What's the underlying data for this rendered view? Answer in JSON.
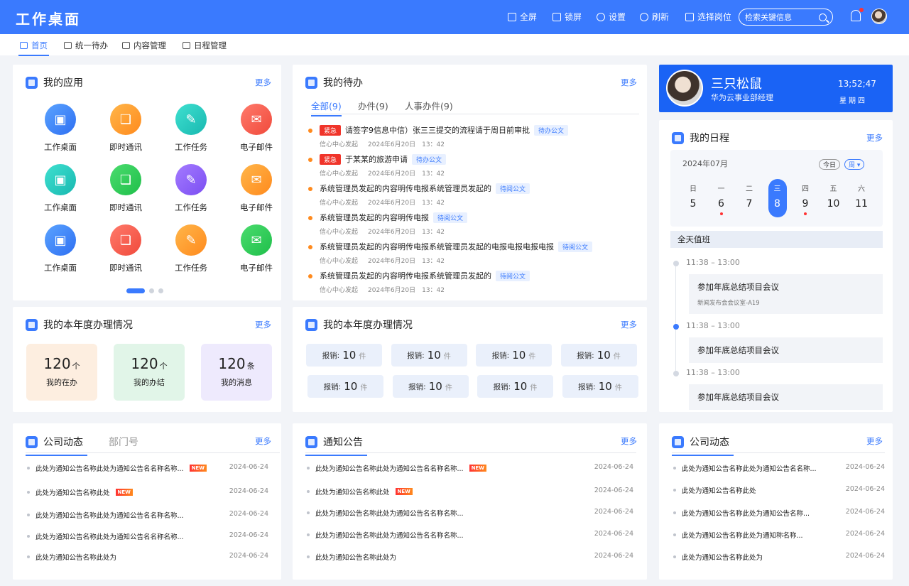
{
  "header": {
    "title": "工作桌面",
    "actions": [
      {
        "label": "全屏",
        "icon": "fullscreen-icon"
      },
      {
        "label": "锁屏",
        "icon": "lock-icon"
      },
      {
        "label": "设置",
        "icon": "gear-icon"
      },
      {
        "label": "刷新",
        "icon": "refresh-icon"
      },
      {
        "label": "选择岗位",
        "icon": "select-icon"
      }
    ],
    "search_placeholder": "检索关键信息",
    "accent": "#3a7afe"
  },
  "nav": {
    "tabs": [
      {
        "label": "首页"
      },
      {
        "label": "统一待办"
      },
      {
        "label": "内容管理"
      },
      {
        "label": "日程管理"
      }
    ]
  },
  "apps": {
    "title": "我的应用",
    "more": "更多",
    "items": [
      {
        "label": "工作桌面",
        "icon": "monitor-icon",
        "color": "blue"
      },
      {
        "label": "即时通讯",
        "icon": "chat-icon",
        "color": "orange"
      },
      {
        "label": "工作任务",
        "icon": "task-icon",
        "color": "teal"
      },
      {
        "label": "电子邮件",
        "icon": "mail-icon",
        "color": "red"
      },
      {
        "label": "工作桌面",
        "icon": "monitor-icon",
        "color": "teal"
      },
      {
        "label": "即时通讯",
        "icon": "chat-icon",
        "color": "green"
      },
      {
        "label": "工作任务",
        "icon": "task-icon",
        "color": "purple"
      },
      {
        "label": "电子邮件",
        "icon": "mail-icon",
        "color": "orange"
      },
      {
        "label": "工作桌面",
        "icon": "monitor-icon",
        "color": "blue"
      },
      {
        "label": "即时通讯",
        "icon": "chat-icon",
        "color": "red"
      },
      {
        "label": "工作任务",
        "icon": "task-icon",
        "color": "orange"
      },
      {
        "label": "电子邮件",
        "icon": "mail-icon",
        "color": "green"
      }
    ]
  },
  "todo": {
    "title": "我的待办",
    "more": "更多",
    "tabs": [
      "全部(9)",
      "办件(9)",
      "人事办件(9)"
    ],
    "urgent_label": "紧急",
    "items": [
      {
        "urgent": true,
        "text": "请签字9信息中信）张三三提交的流程请于周日前审批",
        "tag": "待办公文",
        "source": "信心中心发起",
        "time": "2024年6月20日　13：42"
      },
      {
        "urgent": true,
        "text": "于某某的旅游申请",
        "tag": "待办公文",
        "source": "信心中心发起",
        "time": "2024年6月20日　13：42"
      },
      {
        "urgent": false,
        "text": "系统管理员发起的内容明传电报系统管理员发起的",
        "tag": "待阅公文",
        "source": "信心中心发起",
        "time": "2024年6月20日　13：42"
      },
      {
        "urgent": false,
        "text": "系统管理员发起的内容明传电报",
        "tag": "待阅公文",
        "source": "信心中心发起",
        "time": "2024年6月20日　13：42"
      },
      {
        "urgent": false,
        "text": "系统管理员发起的内容明传电报系统管理员发起的电报电报电报电报",
        "tag": "待阅公文",
        "source": "信心中心发起",
        "time": "2024年6月20日　13：42"
      },
      {
        "urgent": false,
        "text": "系统管理员发起的内容明传电报系统管理员发起的",
        "tag": "待阅公文",
        "source": "信心中心发起",
        "time": "2024年6月20日　13：42"
      }
    ]
  },
  "profile": {
    "name": "三只松鼠",
    "role": "华为云事业部经理",
    "time": "13;52;47",
    "weekday": "星期四"
  },
  "schedule": {
    "title": "我的日程",
    "more": "更多",
    "month": "2024年07月",
    "today_btn": "今日",
    "view_btn": "周 ▾",
    "days": [
      {
        "n": "日",
        "d": "5",
        "dot": false,
        "on": false
      },
      {
        "n": "一",
        "d": "6",
        "dot": true,
        "on": false
      },
      {
        "n": "二",
        "d": "7",
        "dot": false,
        "on": false
      },
      {
        "n": "三",
        "d": "8",
        "dot": false,
        "on": true
      },
      {
        "n": "四",
        "d": "9",
        "dot": true,
        "on": false
      },
      {
        "n": "五",
        "d": "10",
        "dot": false,
        "on": false
      },
      {
        "n": "六",
        "d": "11",
        "dot": false,
        "on": false
      }
    ],
    "allday": "全天值班",
    "events": [
      {
        "time": "11:38 – 13:00",
        "title": "参加年底总结项目会议",
        "place": "新闻发布会会议室-A19",
        "active": false
      },
      {
        "time": "11:38 – 13:00",
        "title": "参加年底总结项目会议",
        "place": "",
        "active": true
      },
      {
        "time": "11:38 – 13:00",
        "title": "参加年底总结项目会议",
        "place": "",
        "active": false
      }
    ]
  },
  "yearstats": {
    "title": "我的本年度办理情况",
    "more": "更多",
    "items": [
      {
        "num": "120",
        "unit": "个",
        "label": "我的在办",
        "bg": "#fdeee0"
      },
      {
        "num": "120",
        "unit": "个",
        "label": "我的办结",
        "bg": "#e1f5e8"
      },
      {
        "num": "120",
        "unit": "条",
        "label": "我的消息",
        "bg": "#eeeafd"
      }
    ]
  },
  "yearstats2": {
    "title": "我的本年度办理情况",
    "more": "更多",
    "chips": [
      {
        "label": "报销:",
        "num": "10",
        "unit": "件"
      },
      {
        "label": "报销:",
        "num": "10",
        "unit": "件"
      },
      {
        "label": "报销:",
        "num": "10",
        "unit": "件"
      },
      {
        "label": "报销:",
        "num": "10",
        "unit": "件"
      },
      {
        "label": "报销:",
        "num": "10",
        "unit": "件"
      },
      {
        "label": "报销:",
        "num": "10",
        "unit": "件"
      },
      {
        "label": "报销:",
        "num": "10",
        "unit": "件"
      },
      {
        "label": "报销:",
        "num": "10",
        "unit": "件"
      }
    ]
  },
  "news1": {
    "tab1": "公司动态",
    "tab2": "部门号",
    "more": "更多",
    "new_badge": "NEW",
    "items": [
      {
        "text": "此处为通知公告名称此处为通知公告名名称名称...",
        "new": true,
        "date": "2024-06-24"
      },
      {
        "text": "此处为通知公告名称此处",
        "new": true,
        "date": "2024-06-24"
      },
      {
        "text": "此处为通知公告名称此处为通知公告名名称名称...",
        "new": false,
        "date": "2024-06-24"
      },
      {
        "text": "此处为通知公告名称此处为通知公告名名称名称...",
        "new": false,
        "date": "2024-06-24"
      },
      {
        "text": "此处为通知公告名称此处为",
        "new": false,
        "date": "2024-06-24"
      }
    ]
  },
  "news2": {
    "tab1": "通知公告",
    "more": "更多",
    "new_badge": "NEW",
    "items": [
      {
        "text": "此处为通知公告名称此处为通知公告名名称名称...",
        "new": true,
        "date": "2024-06-24"
      },
      {
        "text": "此处为通知公告名称此处",
        "new": true,
        "date": "2024-06-24"
      },
      {
        "text": "此处为通知公告名称此处为通知公告名名称名称...",
        "new": false,
        "date": "2024-06-24"
      },
      {
        "text": "此处为通知公告名称此处为通知公告名名称名称...",
        "new": false,
        "date": "2024-06-24"
      },
      {
        "text": "此处为通知公告名称此处为",
        "new": false,
        "date": "2024-06-24"
      }
    ]
  },
  "news3": {
    "tab1": "公司动态",
    "more": "更多",
    "items": [
      {
        "text": "此处为通知公告名称此处为通知公告名名称...",
        "new": false,
        "date": "2024-06-24"
      },
      {
        "text": "此处为通知公告名称此处",
        "new": false,
        "date": "2024-06-24"
      },
      {
        "text": "此处为通知公告名称此处为通知公告名称...",
        "new": false,
        "date": "2024-06-24"
      },
      {
        "text": "此处为通知公告名称此处为通知称名称...",
        "new": false,
        "date": "2024-06-24"
      },
      {
        "text": "此处为通知公告名称此处为",
        "new": false,
        "date": "2024-06-24"
      }
    ]
  }
}
